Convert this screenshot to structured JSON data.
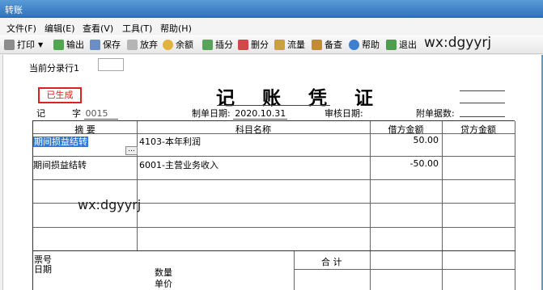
{
  "window": {
    "title": "转账"
  },
  "menu": [
    "文件(F)",
    "编辑(E)",
    "查看(V)",
    "工具(T)",
    "帮助(H)"
  ],
  "toolbar": {
    "print": "打印",
    "export": "输出",
    "save": "保存",
    "discard": "放弃",
    "balance": "余额",
    "insert": "插分",
    "delete": "删分",
    "flow": "流量",
    "note": "备查",
    "help": "帮助",
    "exit": "退出"
  },
  "watermark": "wx:dgyyrj",
  "current_row_label": "当前分录行1",
  "voucher": {
    "stamp": "已生成",
    "title": "记 账 凭 证",
    "type": "记",
    "number_label": "字",
    "number": "0015",
    "date_label": "制单日期:",
    "date": "2020.10.31",
    "audit_label": "审核日期:",
    "attach_label": "附单据数:",
    "headers": {
      "summary": "摘 要",
      "account": "科目名称",
      "debit": "借方金额",
      "credit": "贷方金额"
    },
    "rows": [
      {
        "summary": "期间损益结转",
        "account": "4103-本年利润",
        "debit": "50.00",
        "credit": ""
      },
      {
        "summary": "期间损益结转",
        "account": "6001-主营业务收入",
        "debit": "-50.00",
        "credit": ""
      }
    ],
    "footer": {
      "ticket_no": "票号",
      "date": "日期",
      "qty": "数量",
      "price": "单价",
      "total": "合 计"
    }
  },
  "colors": {
    "titlebar": "#3d82cc",
    "stamp": "#e0201a",
    "selection": "#3378d6"
  }
}
